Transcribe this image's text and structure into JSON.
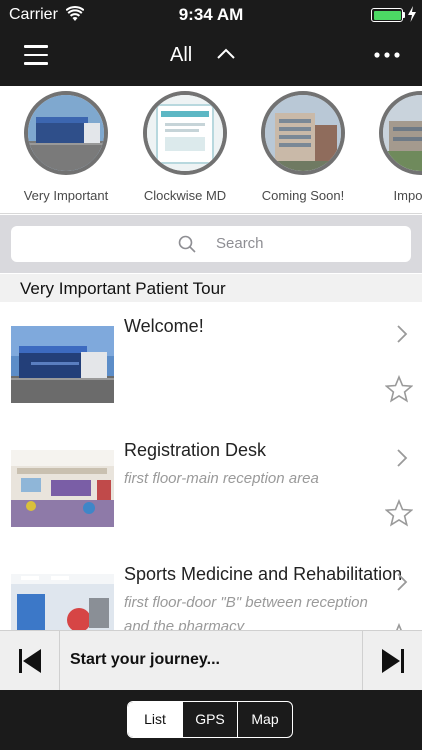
{
  "status_bar": {
    "carrier": "Carrier",
    "time": "9:34 AM",
    "battery_level": 1.0
  },
  "nav": {
    "title": "All",
    "menu_icon": "hamburger-icon",
    "caret_icon": "chevron-up-icon",
    "more_icon": "ellipsis-icon"
  },
  "carousel": {
    "items": [
      {
        "label": "Very Important"
      },
      {
        "label": "Clockwise MD"
      },
      {
        "label": "Coming Soon!"
      },
      {
        "label": "Important"
      }
    ]
  },
  "search": {
    "placeholder": "Search"
  },
  "section": {
    "title": "Very Important Patient Tour"
  },
  "list": {
    "items": [
      {
        "title": "Welcome!",
        "subtitle": ""
      },
      {
        "title": "Registration Desk",
        "subtitle": "first floor-main reception area"
      },
      {
        "title": "Sports Medicine and Rehabilitation",
        "subtitle": "first floor-door \"B\" between reception and the pharmacy"
      }
    ]
  },
  "player": {
    "label": "Start your journey..."
  },
  "tabs": {
    "items": [
      {
        "label": "List"
      },
      {
        "label": "GPS"
      },
      {
        "label": "Map"
      }
    ],
    "selected": "List"
  },
  "colors": {
    "bar_background": "#1b1b1b",
    "battery": "#4cd964",
    "secondary_text": "#9a9a9a"
  }
}
